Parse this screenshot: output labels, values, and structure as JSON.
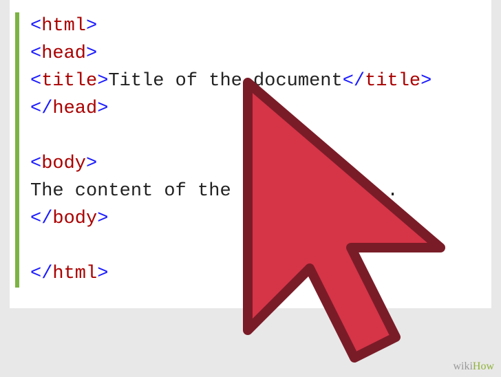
{
  "code": {
    "lines": [
      {
        "parts": [
          {
            "type": "bracket",
            "text": "<"
          },
          {
            "type": "tag",
            "text": "html"
          },
          {
            "type": "bracket",
            "text": ">"
          }
        ]
      },
      {
        "parts": [
          {
            "type": "bracket",
            "text": "<"
          },
          {
            "type": "tag",
            "text": "head"
          },
          {
            "type": "bracket",
            "text": ">"
          }
        ]
      },
      {
        "parts": [
          {
            "type": "bracket",
            "text": "<"
          },
          {
            "type": "tag",
            "text": "title"
          },
          {
            "type": "bracket",
            "text": ">"
          },
          {
            "type": "txt",
            "text": "Title of the document"
          },
          {
            "type": "bracket",
            "text": "</"
          },
          {
            "type": "tag",
            "text": "title"
          },
          {
            "type": "bracket",
            "text": ">"
          }
        ]
      },
      {
        "parts": [
          {
            "type": "bracket",
            "text": "</"
          },
          {
            "type": "tag",
            "text": "head"
          },
          {
            "type": "bracket",
            "text": ">"
          }
        ]
      },
      {
        "parts": []
      },
      {
        "parts": [
          {
            "type": "bracket",
            "text": "<"
          },
          {
            "type": "tag",
            "text": "body"
          },
          {
            "type": "bracket",
            "text": ">"
          }
        ]
      },
      {
        "parts": [
          {
            "type": "txt",
            "text": "The content of the document......"
          }
        ]
      },
      {
        "parts": [
          {
            "type": "bracket",
            "text": "</"
          },
          {
            "type": "tag",
            "text": "body"
          },
          {
            "type": "bracket",
            "text": ">"
          }
        ]
      },
      {
        "parts": []
      },
      {
        "parts": [
          {
            "type": "bracket",
            "text": "</"
          },
          {
            "type": "tag",
            "text": "html"
          },
          {
            "type": "bracket",
            "text": ">"
          }
        ]
      }
    ]
  },
  "watermark": {
    "prefix": "wiki",
    "suffix": "How"
  },
  "cursor": {
    "fill": "#d63447",
    "stroke": "#7a1c28"
  }
}
